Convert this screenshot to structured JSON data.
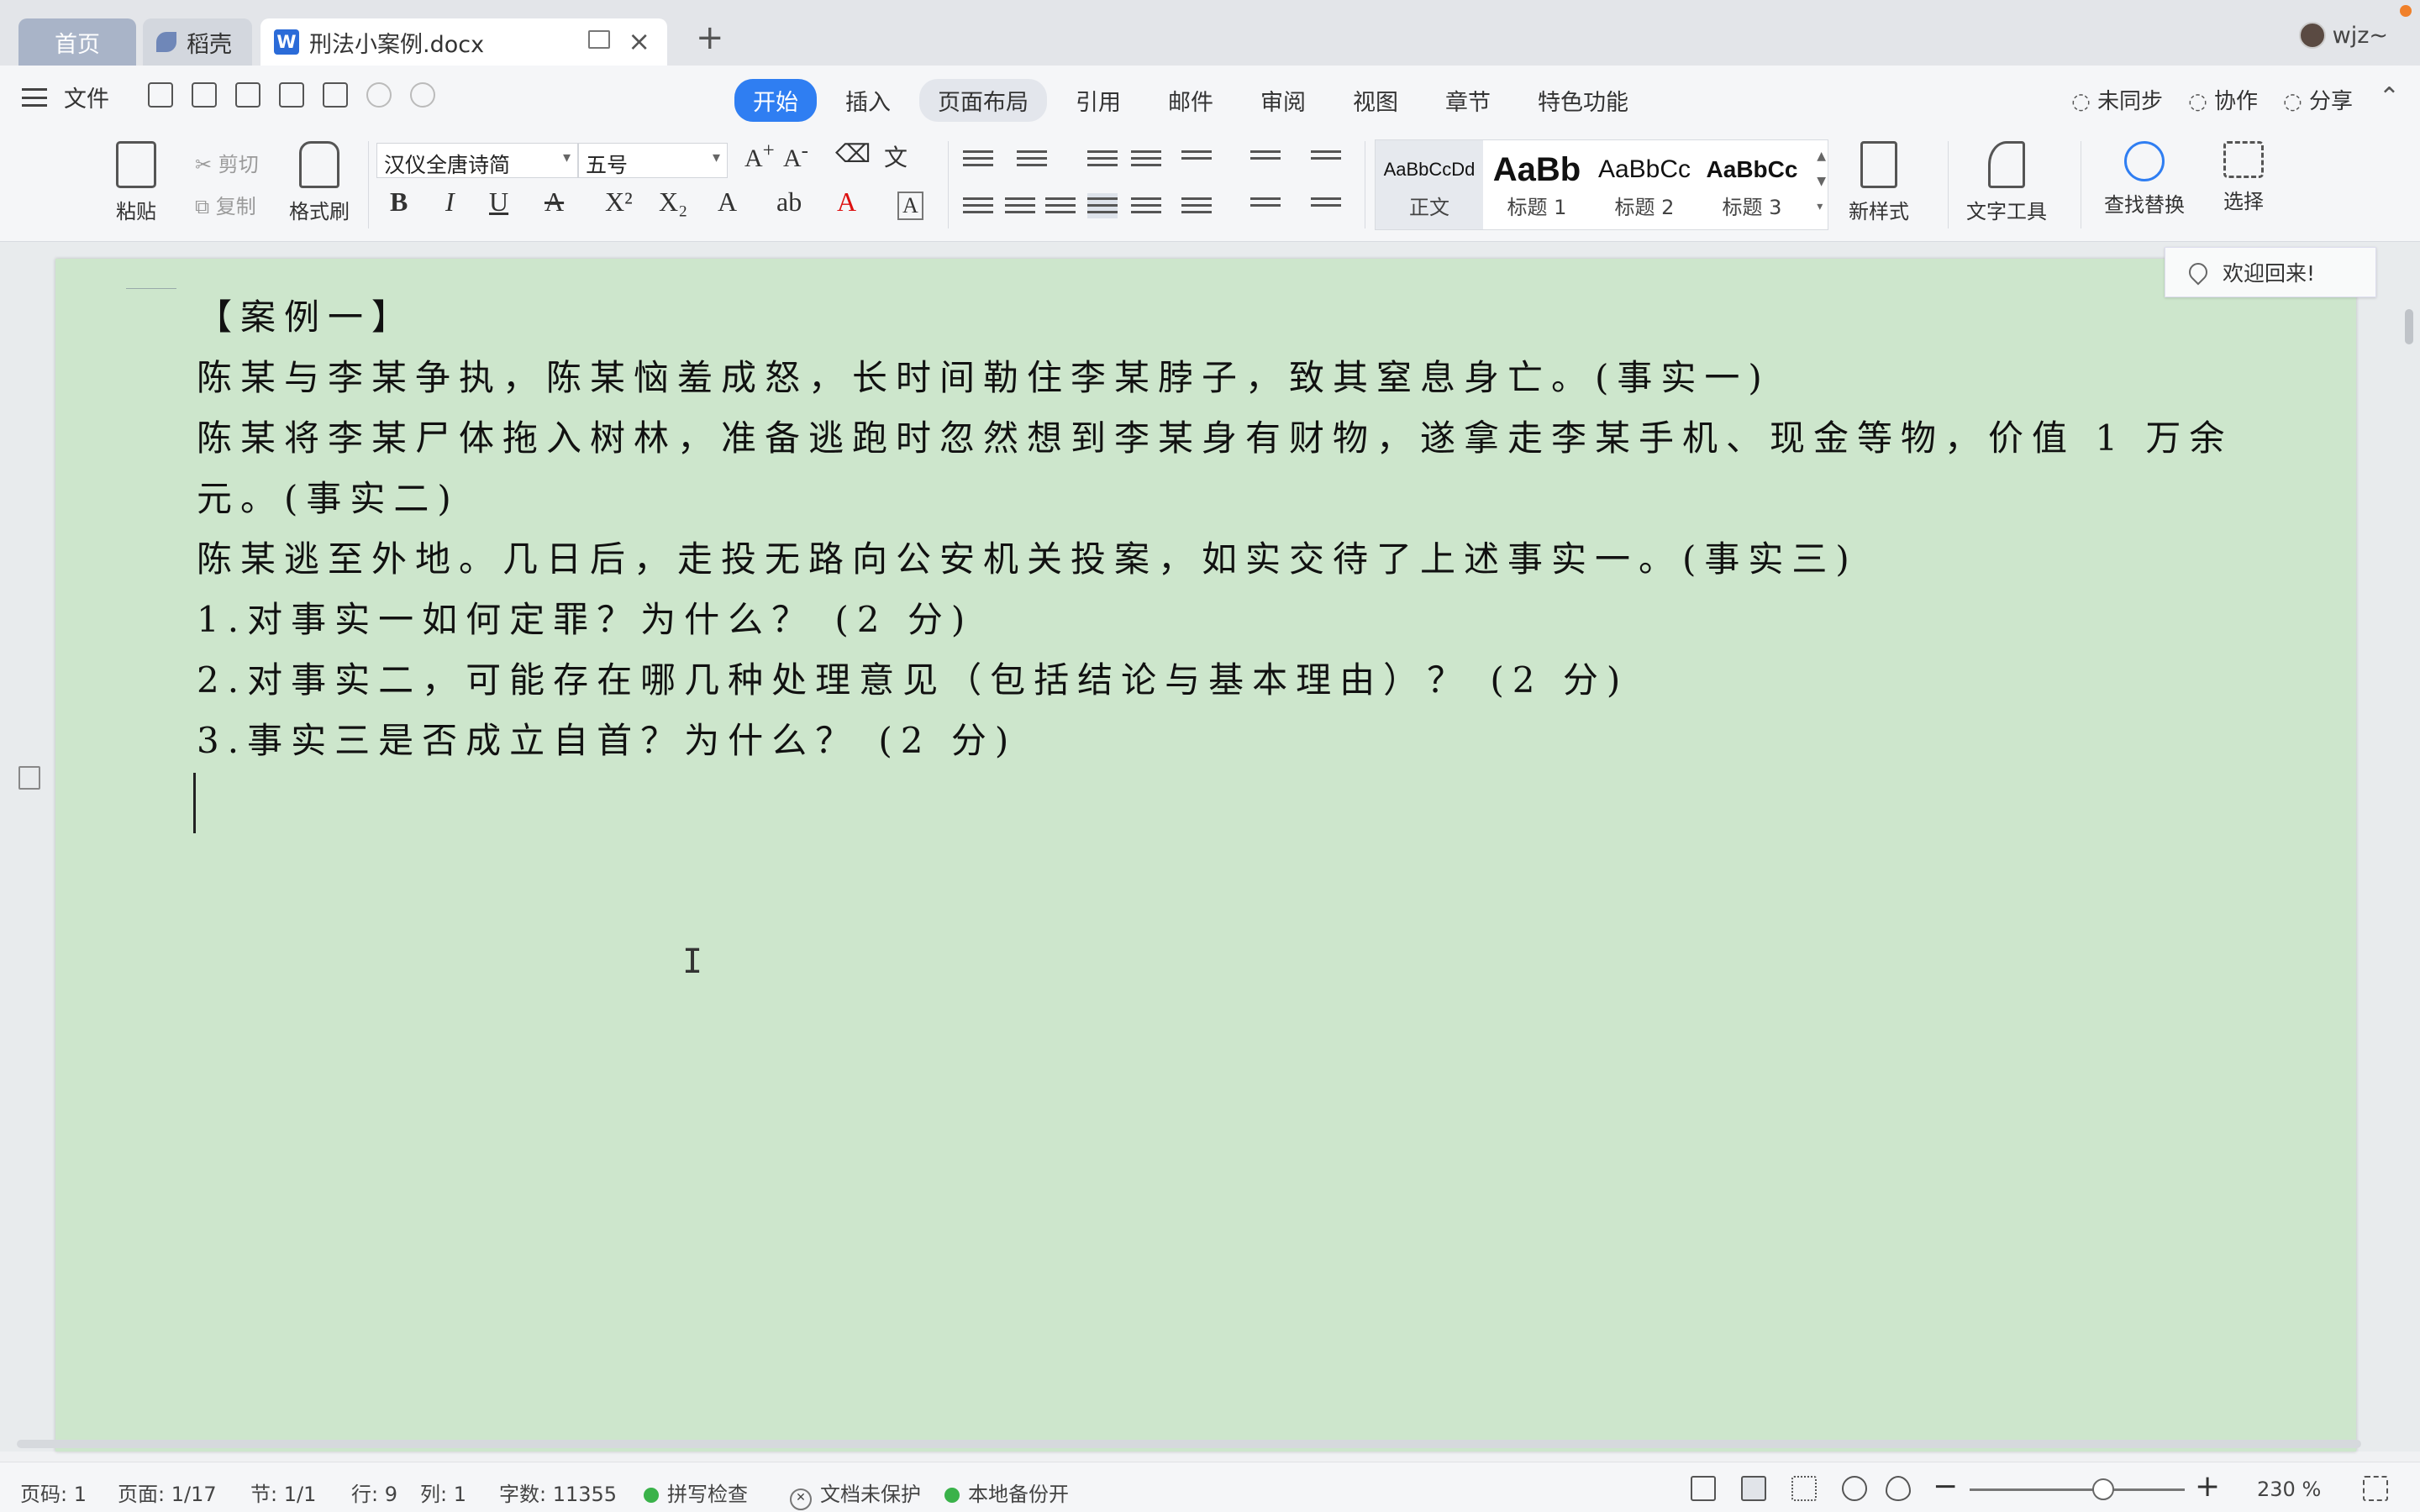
{
  "tabs": {
    "home": "首页",
    "daoke": "稻壳",
    "document": "刑法小案例.docx",
    "doc_icon_letter": "W",
    "new_tab": "+"
  },
  "user": {
    "name": "wjz~"
  },
  "menu": {
    "file": "文件",
    "ribbon_tabs": [
      "开始",
      "插入",
      "页面布局",
      "引用",
      "邮件",
      "审阅",
      "视图",
      "章节",
      "特色功能"
    ],
    "active_tab": "开始",
    "right": [
      "未同步",
      "协作",
      "分享"
    ]
  },
  "ribbon": {
    "paste": "粘贴",
    "cut": "剪切",
    "copy": "复制",
    "format_painter": "格式刷",
    "font_name": "汉仪全唐诗简",
    "font_size": "五号",
    "styles": [
      {
        "sample": "AaBbCcDd",
        "name": "正文"
      },
      {
        "sample": "AaBb",
        "name": "标题 1"
      },
      {
        "sample": "AaBbCc",
        "name": "标题 2"
      },
      {
        "sample": "AaBbCc",
        "name": "标题 3"
      }
    ],
    "new_style": "新样式",
    "text_tools": "文字工具",
    "find_replace": "查找替换",
    "select": "选择"
  },
  "document": {
    "paragraphs": [
      "【案例一】",
      "陈某与李某争执，陈某恼羞成怒，长时间勒住李某脖子，致其窒息身亡。(事实一)",
      "陈某将李某尸体拖入树林，准备逃跑时忽然想到李某身有财物，遂拿走李某手机、现金等物，价值 1 万余元。(事实二)",
      "陈某逃至外地。几日后，走投无路向公安机关投案，如实交待了上述事实一。(事实三)",
      "1.对事实一如何定罪？为什么？ (2 分)",
      "2.对事实二，可能存在哪几种处理意见（包括结论与基本理由）？ (2 分)",
      "3.事实三是否成立自首？为什么？ (2 分)"
    ],
    "page_color": "#cde6cc"
  },
  "popup": {
    "welcome": "欢迎回来!"
  },
  "status": {
    "page_code": "页码: 1",
    "page": "页面: 1/17",
    "section": "节: 1/1",
    "row": "行: 9",
    "col": "列: 1",
    "words": "字数: 11355",
    "spell": "拼写检查",
    "protect": "文档未保护",
    "backup": "本地备份开",
    "zoom": "230 %"
  },
  "colors": {
    "accent": "#2f7ef2",
    "ok": "#3ab24a"
  }
}
